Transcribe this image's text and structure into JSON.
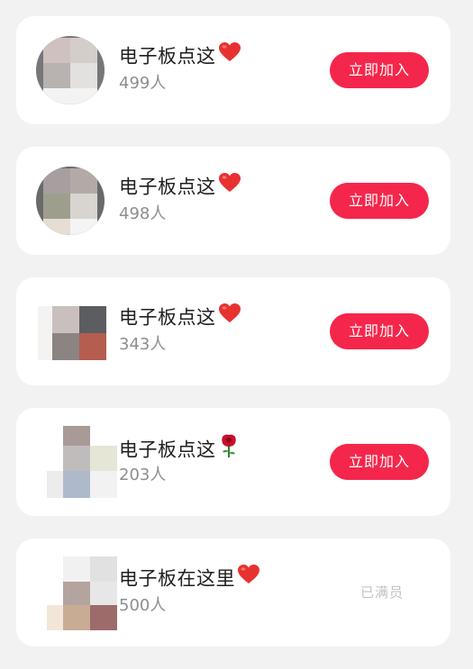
{
  "groups": [
    {
      "name": "电子板点这",
      "emoji": "heart-icon",
      "members": "499人",
      "action": "立即加入"
    },
    {
      "name": "电子板点这",
      "emoji": "heart-icon",
      "members": "498人",
      "action": "立即加入"
    },
    {
      "name": "电子板点这",
      "emoji": "heart-icon",
      "members": "343人",
      "action": "立即加入"
    },
    {
      "name": "电子板点这",
      "emoji": "rose-icon",
      "members": "203人",
      "action": "立即加入"
    },
    {
      "name": "电子板在这里",
      "emoji": "heart-icon",
      "members": "500人",
      "status": "已满员"
    }
  ],
  "colors": {
    "background": "#f2f2f2",
    "card": "#ffffff",
    "join_button": "#f5264b",
    "full_text": "#c2c2c2",
    "count_text": "#8e8e8e"
  }
}
